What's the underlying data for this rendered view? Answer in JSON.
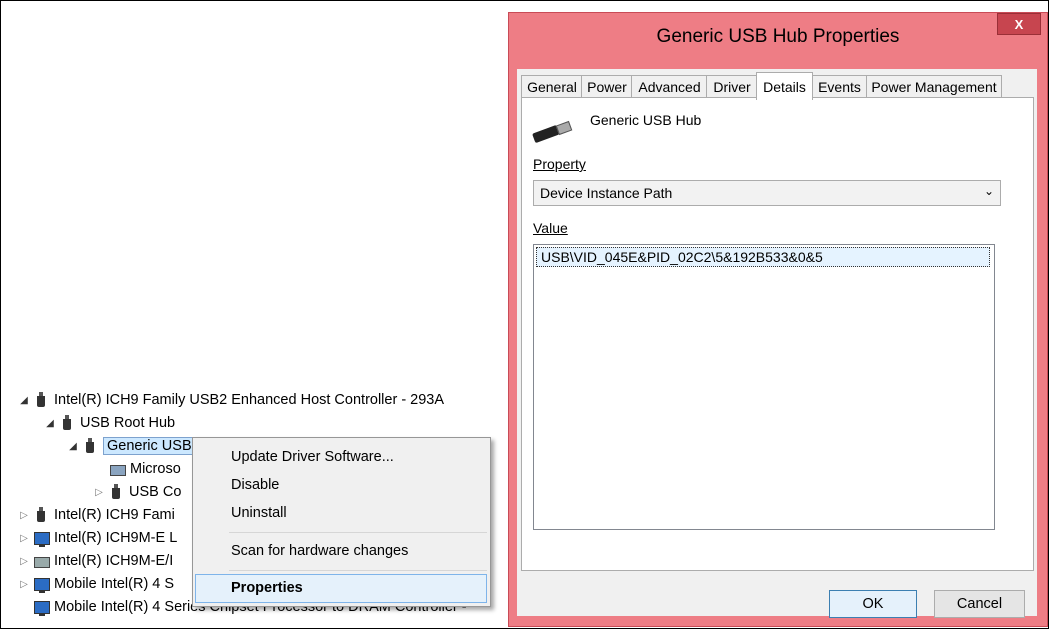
{
  "tree": {
    "items": [
      {
        "label": "Intel(R) ICH9 Family USB2 Enhanced Host Controller - 293A",
        "arrow": "◢",
        "icon": "usb-plug-icon"
      },
      {
        "label": "USB Root Hub",
        "arrow": "◢",
        "icon": "usb-plug-icon"
      },
      {
        "label": "Generic USB Hub",
        "arrow": "◢",
        "icon": "usb-plug-icon"
      },
      {
        "label": "Microso",
        "arrow": "",
        "icon": "keyboard-mouse-icon"
      },
      {
        "label": "USB Co",
        "arrow": "▷",
        "icon": "usb-plug-icon"
      },
      {
        "label": "Intel(R) ICH9 Fami",
        "arrow": "▷",
        "icon": "usb-plug-icon"
      },
      {
        "label": "Intel(R) ICH9M-E L",
        "arrow": "▷",
        "icon": "network-icon"
      },
      {
        "label": "Intel(R) ICH9M-E/I",
        "arrow": "▷",
        "icon": "disk-controller-icon"
      },
      {
        "label": "Mobile Intel(R) 4 S",
        "arrow": "▷",
        "icon": "network-icon"
      },
      {
        "label": "Mobile Intel(R) 4 Series Chipset Processor to DRAM Controller -",
        "arrow": "",
        "icon": "network-icon"
      }
    ]
  },
  "context_menu": {
    "update": "Update Driver Software...",
    "disable": "Disable",
    "uninstall": "Uninstall",
    "scan": "Scan for hardware changes",
    "properties": "Properties"
  },
  "dialog": {
    "title": "Generic USB Hub Properties",
    "close_glyph": "X",
    "tabs": [
      "General",
      "Power",
      "Advanced",
      "Driver",
      "Details",
      "Events",
      "Power Management"
    ],
    "active_tab": "Details",
    "device_name": "Generic USB Hub",
    "property_label": "Property",
    "property_value": "Device Instance Path",
    "value_label": "Value",
    "value_text": "USB\\VID_045E&PID_02C2\\5&192B533&0&5",
    "ok_label": "OK",
    "cancel_label": "Cancel"
  },
  "colors": {
    "title_bar": "#ee7d85",
    "selection": "#cce8ff",
    "menu_highlight": "#e5f1fb"
  }
}
